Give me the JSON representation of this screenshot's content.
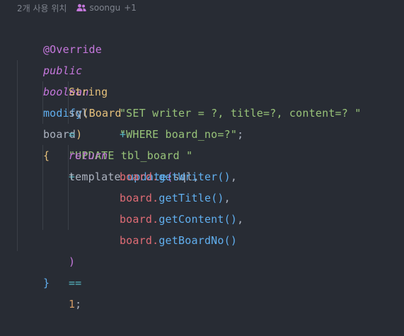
{
  "codelens": {
    "usages": "2개 사용 위치",
    "author": "soongu",
    "extra_authors": "+1",
    "author_icon": "people-icon"
  },
  "code": {
    "annotation": "@Override",
    "l2_public": "public",
    "l2_boolean": "boolean",
    "l2_method": "modify",
    "l2_open_paren": "(",
    "l2_type": "Board",
    "l2_param": "board",
    "l2_close_paren": ")",
    "l2_brace": "{",
    "l3_type": "String",
    "l3_var": "sql",
    "l3_eq": "=",
    "l3_str": "\"UPDATE tbl_board \"",
    "l3_plus": "+",
    "l4_str": "\"SET writer = ?, title=?, content=? \"",
    "l4_plus": "+",
    "l5_str": "\"WHERE board_no=?\"",
    "l5_semi": ";",
    "l6_return": "return",
    "l6_obj": "template",
    "l6_dot": ".",
    "l6_method": "update",
    "l6_open": "(",
    "l6_arg": "sql",
    "l6_comma": ",",
    "l7_obj": "board",
    "l7_dot": ".",
    "l7_method": "getWriter",
    "l7_parens": "()",
    "l7_comma": ",",
    "l8_obj": "board",
    "l8_dot": ".",
    "l8_method": "getTitle",
    "l8_parens": "()",
    "l8_comma": ",",
    "l9_obj": "board",
    "l9_dot": ".",
    "l9_method": "getContent",
    "l9_parens": "()",
    "l9_comma": ",",
    "l10_obj": "board",
    "l10_dot": ".",
    "l10_method": "getBoardNo",
    "l10_parens": "()",
    "l11_close": ")",
    "l11_op": "==",
    "l11_num": "1",
    "l11_semi": ";",
    "l12_brace": "}"
  },
  "colors": {
    "background": "#282c34",
    "keyword": "#c678dd",
    "function": "#61afef",
    "type": "#e5c07b",
    "string": "#98c379",
    "parameter": "#e06c75",
    "number": "#d19a66",
    "operator": "#56b6c2",
    "text": "#abb2bf",
    "codelens": "#7f848e"
  }
}
